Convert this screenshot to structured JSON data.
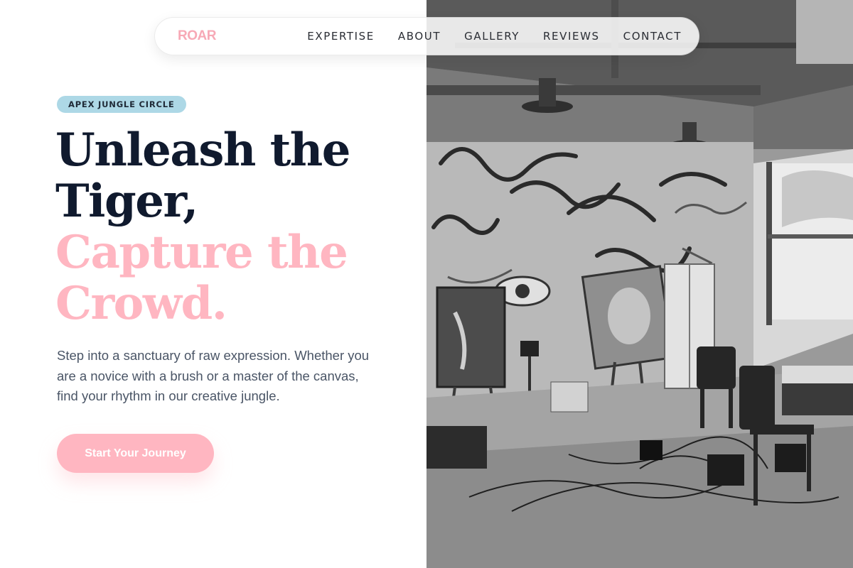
{
  "nav": {
    "brand": "ROAR",
    "items": [
      {
        "label": "EXPERTISE"
      },
      {
        "label": "ABOUT"
      },
      {
        "label": "GALLERY"
      },
      {
        "label": "REVIEWS"
      },
      {
        "label": "CONTACT"
      }
    ]
  },
  "hero": {
    "badge": "APEX JUNGLE CIRCLE",
    "headline_line1": "Unleash the",
    "headline_line2": "Tiger,",
    "headline_line3": "Capture the",
    "headline_line4": "Crowd.",
    "description": "Step into a sanctuary of raw expression. Whether you are a novice with a brush or a master of the canvas, find your rhythm in our creative jungle.",
    "cta_label": "Start Your Journey"
  },
  "image": {
    "icon": "art-studio-photo"
  },
  "colors": {
    "accent_pink": "#ffb6c1",
    "badge_blue": "#add8e6",
    "headline_dark": "#101a2e",
    "body_text": "#4a5566"
  }
}
